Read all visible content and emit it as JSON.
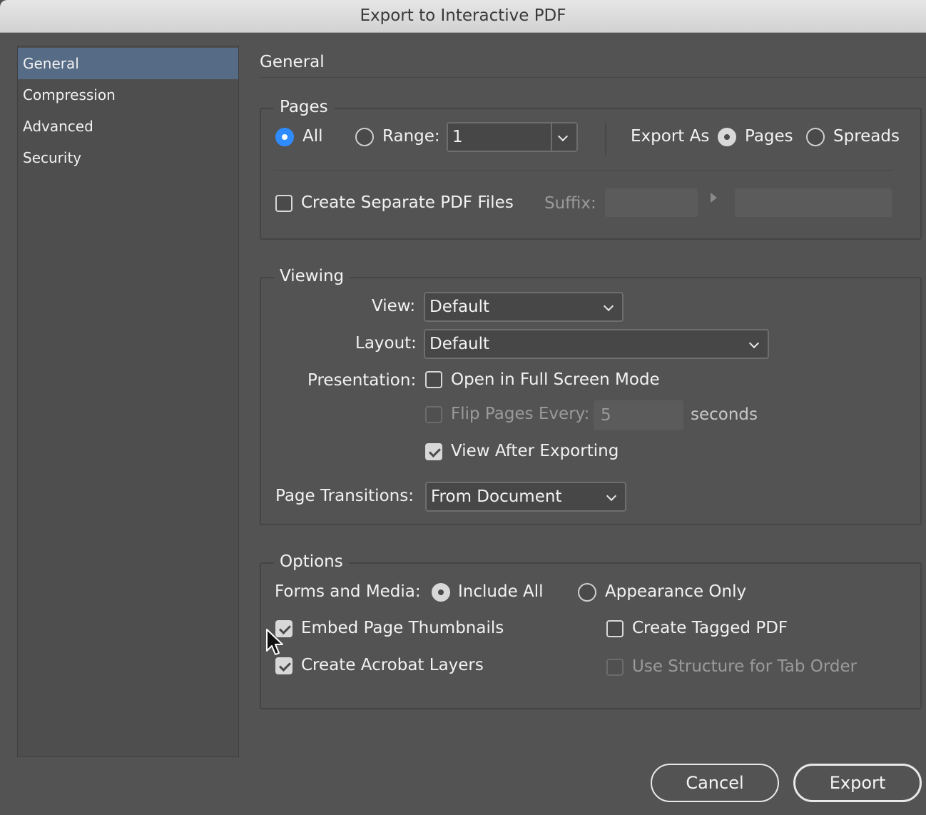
{
  "window": {
    "title": "Export to Interactive PDF"
  },
  "sidebar": {
    "items": [
      {
        "label": "General",
        "selected": true
      },
      {
        "label": "Compression",
        "selected": false
      },
      {
        "label": "Advanced",
        "selected": false
      },
      {
        "label": "Security",
        "selected": false
      }
    ]
  },
  "panel": {
    "heading": "General"
  },
  "pages": {
    "legend": "Pages",
    "all_label": "All",
    "range_label": "Range:",
    "range_value": "1",
    "export_as_label": "Export As",
    "pages_label": "Pages",
    "spreads_label": "Spreads",
    "separate_label": "Create Separate PDF Files",
    "separate_checked": false,
    "suffix_label": "Suffix:"
  },
  "viewing": {
    "legend": "Viewing",
    "view_label": "View:",
    "view_value": "Default",
    "layout_label": "Layout:",
    "layout_value": "Default",
    "presentation_label": "Presentation:",
    "fullscreen_label": "Open in Full Screen Mode",
    "fullscreen_checked": false,
    "flip_label": "Flip Pages Every:",
    "flip_value": "5",
    "seconds_label": "seconds",
    "view_after_label": "View After Exporting",
    "view_after_checked": true,
    "transitions_label": "Page Transitions:",
    "transitions_value": "From Document"
  },
  "options": {
    "legend": "Options",
    "forms_label": "Forms and Media:",
    "include_all_label": "Include All",
    "appearance_only_label": "Appearance Only",
    "thumbnails_label": "Embed Page Thumbnails",
    "thumbnails_checked": true,
    "layers_label": "Create Acrobat Layers",
    "layers_checked": true,
    "tagged_label": "Create Tagged PDF",
    "tagged_checked": false,
    "structure_label": "Use Structure for Tab Order",
    "structure_checked": false
  },
  "buttons": {
    "cancel": "Cancel",
    "export": "Export"
  },
  "colors": {
    "selection": "#566b85",
    "radio_accent": "#2f8cff",
    "background": "#535353"
  }
}
